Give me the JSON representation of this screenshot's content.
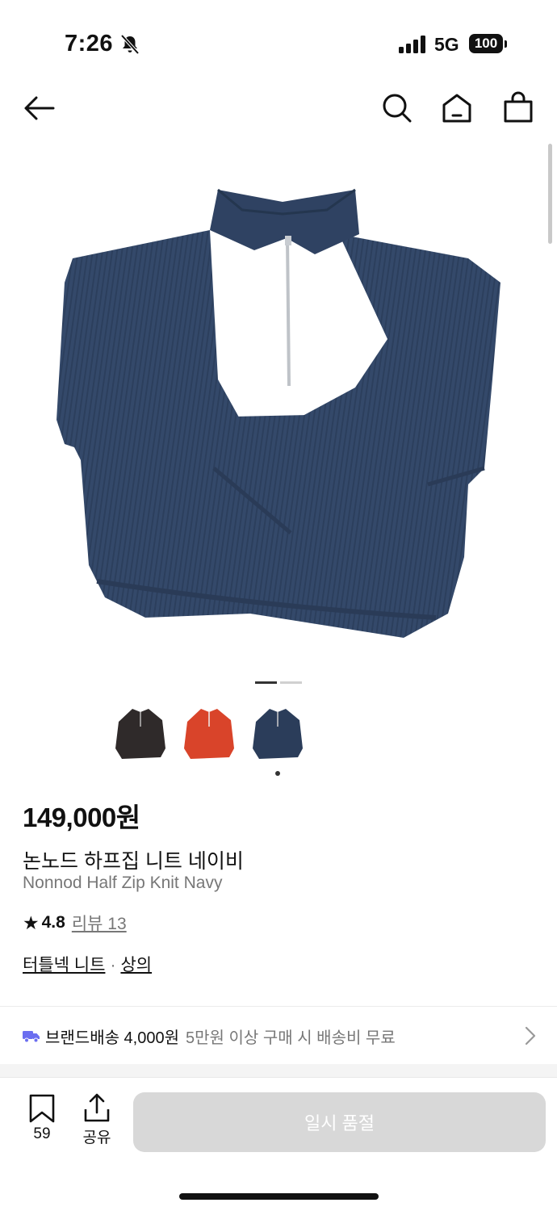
{
  "status_bar": {
    "time": "7:26",
    "network": "5G",
    "battery": "100"
  },
  "product": {
    "price": "149,000원",
    "name_ko": "논노드 하프집 니트 네이비",
    "name_en": "Nonnod Half Zip Knit Navy",
    "rating": "4.8",
    "review_label": "리뷰 13",
    "category_1": "터틀넥 니트",
    "category_sep": "·",
    "category_2": "상의",
    "swatches": [
      {
        "color": "#2f2a2a",
        "selected": false
      },
      {
        "color": "#d9442a",
        "selected": false
      },
      {
        "color": "#2b3d5a",
        "selected": true
      }
    ],
    "main_color": "#34496a",
    "image_pages": {
      "current": 1,
      "total": 2
    }
  },
  "shipping": {
    "label": "브랜드배송 4,000원",
    "note": "5만원 이상 구매 시 배송비 무료"
  },
  "bottom_bar": {
    "bookmark_count": "59",
    "share_label": "공유",
    "soldout_label": "일시 품절"
  },
  "icons": [
    "back-arrow-icon",
    "search-icon",
    "home-icon",
    "shopping-bag-icon",
    "star-icon",
    "truck-icon",
    "chevron-right-icon",
    "bookmark-icon",
    "share-icon",
    "bell-off-icon"
  ]
}
